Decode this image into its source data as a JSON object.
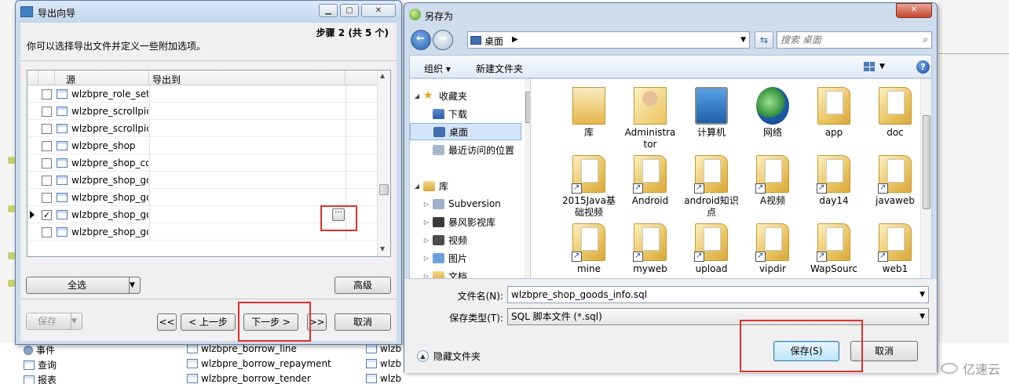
{
  "wizard": {
    "title": "导出向导",
    "step": "步骤 2 (共 5 个)",
    "description": "你可以选择导出文件并定义一些附加选项。",
    "columns": {
      "source": "源",
      "export_to": "导出到"
    },
    "rows": [
      {
        "name": "wlzbpre_role_set",
        "checked": false
      },
      {
        "name": "wlzbpre_scrollpic",
        "checked": false
      },
      {
        "name": "wlzbpre_scrollpic",
        "checked": false
      },
      {
        "name": "wlzbpre_shop",
        "checked": false
      },
      {
        "name": "wlzbpre_shop_co",
        "checked": false
      },
      {
        "name": "wlzbpre_shop_go",
        "checked": false
      },
      {
        "name": "wlzbpre_shop_go",
        "checked": false
      },
      {
        "name": "wlzbpre_shop_go",
        "checked": true
      },
      {
        "name": "wlzbpre_shop_go",
        "checked": false
      }
    ],
    "ellipsis_label": "···",
    "select_all": "全选",
    "advanced": "高级",
    "save": "保存",
    "first": "<<",
    "prev": "< 上一步",
    "next": "下一步 >",
    "last": ">>",
    "cancel": "取消"
  },
  "saveas": {
    "title": "另存为",
    "address": "桌面",
    "search_placeholder": "搜索 桌面",
    "organize": "组织 ▾",
    "new_folder": "新建文件夹",
    "help": "?",
    "nav": [
      {
        "label": "收藏夹",
        "icon": "star"
      },
      {
        "label": "下载",
        "icon": "dl"
      },
      {
        "label": "桌面",
        "icon": "desk"
      },
      {
        "label": "最近访问的位置",
        "icon": "recent"
      },
      {
        "label": "库",
        "icon": "lib"
      },
      {
        "label": "Subversion",
        "icon": "sub"
      },
      {
        "label": "暴风影视库",
        "icon": "baofeng"
      },
      {
        "label": "视频",
        "icon": "video"
      },
      {
        "label": "图片",
        "icon": "pic"
      },
      {
        "label": "文档",
        "icon": "lib"
      }
    ],
    "files": [
      {
        "label": "库",
        "kind": "library"
      },
      {
        "label": "Administra tor",
        "kind": "user"
      },
      {
        "label": "计算机",
        "kind": "computer"
      },
      {
        "label": "网络",
        "kind": "network"
      },
      {
        "label": "app",
        "kind": "folder"
      },
      {
        "label": "doc",
        "kind": "folder"
      },
      {
        "label": "2015Java基础视频",
        "kind": "shortcut"
      },
      {
        "label": "Android",
        "kind": "shortcut"
      },
      {
        "label": "android知识点",
        "kind": "shortcut"
      },
      {
        "label": "A视频",
        "kind": "shortcut"
      },
      {
        "label": "day14",
        "kind": "shortcut"
      },
      {
        "label": "javaweb",
        "kind": "shortcut"
      },
      {
        "label": "mine",
        "kind": "shortcut"
      },
      {
        "label": "myweb",
        "kind": "shortcut"
      },
      {
        "label": "upload",
        "kind": "shortcut"
      },
      {
        "label": "vipdir",
        "kind": "shortcut"
      },
      {
        "label": "WapSourc",
        "kind": "shortcut"
      },
      {
        "label": "web1",
        "kind": "shortcut"
      }
    ],
    "filename_label": "文件名(N):",
    "filename_value": "wlzbpre_shop_goods_info.sql",
    "filetype_label": "保存类型(T):",
    "filetype_value": "SQL 脚本文件 (*.sql)",
    "hide_folders": "隐藏文件夹",
    "save": "保存(S)",
    "cancel": "取消"
  },
  "background": {
    "tree": [
      {
        "label": "事件"
      },
      {
        "label": "查询"
      },
      {
        "label": "报表"
      }
    ],
    "tables": [
      "wlzbpre_borrow_line",
      "wlzbpre_borrow_repayment",
      "wlzbpre_borrow_tender"
    ],
    "tables_right": [
      "wlzb",
      "wlzb",
      "wlzb"
    ],
    "watermark": "亿速云"
  },
  "colors": {
    "highlight_box": "#e0302a",
    "title_bar": "#cfdcec"
  }
}
